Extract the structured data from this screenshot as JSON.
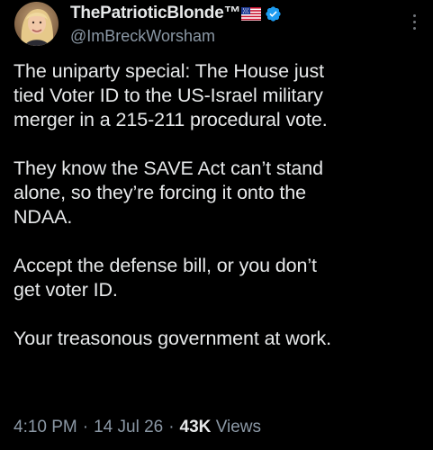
{
  "author": {
    "display_name": "ThePatrioticBlonde™",
    "handle": "@ImBreckWorsham",
    "flag_icon": "us-flag-emoji",
    "verified_icon": "verified-badge-icon",
    "verified_color": "#1d9bf0"
  },
  "tweet": {
    "paragraphs": [
      "The uniparty special: The House just\ntied Voter ID to the US-Israel military\nmerger in a 215-211 procedural vote.",
      "They know the SAVE Act can’t stand\nalone, so they’re forcing it onto the\nNDAA.",
      "Accept the defense bill, or you don’t\nget voter ID.",
      "Your treasonous government at work."
    ]
  },
  "meta": {
    "time": "4:10 PM",
    "separator": "·",
    "date": "14 Jul 26",
    "views_count": "43K",
    "views_label": "Views"
  },
  "colors": {
    "background": "#000000",
    "text": "#e7e9ea",
    "secondary_text": "#8b98a5"
  }
}
